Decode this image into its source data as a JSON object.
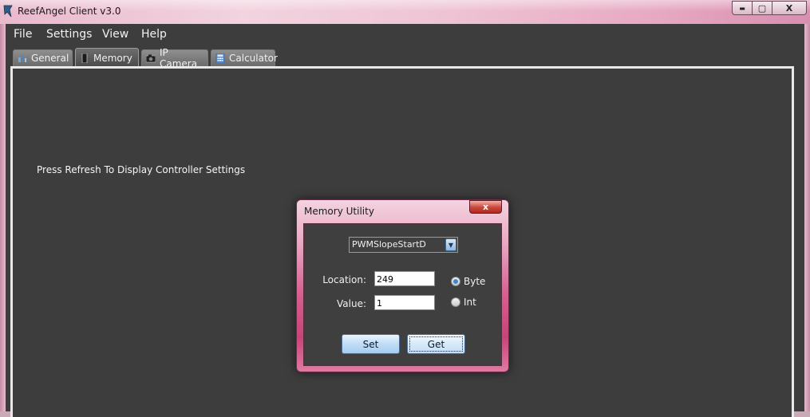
{
  "window": {
    "title": "ReefAngel Client v3.0",
    "controls": {
      "minimize": "▬",
      "maximize": "▢",
      "close": "X"
    }
  },
  "menu": {
    "items": [
      "File",
      "Settings",
      "View",
      "Help"
    ]
  },
  "tabs": [
    {
      "label": "General",
      "icon": "chart-icon",
      "active": false
    },
    {
      "label": "Memory",
      "icon": "memory-chip-icon",
      "active": true
    },
    {
      "label": "IP Camera",
      "icon": "camera-icon",
      "active": false
    },
    {
      "label": "Calculator",
      "icon": "calculator-icon",
      "active": false
    }
  ],
  "main": {
    "hint": "Press Refresh To Display Controller Settings"
  },
  "dialog": {
    "title": "Memory Utility",
    "close_label": "x",
    "select_value": "PWMSlopeStartD",
    "location_label": "Location:",
    "location_value": "249",
    "value_label": "Value:",
    "value_value": "1",
    "radio_byte_label": "Byte",
    "radio_int_label": "Int",
    "radio_selected": "Byte",
    "set_label": "Set",
    "get_label": "Get"
  },
  "colors": {
    "client_bg": "#3d3d3d",
    "frame_accent": "#d65f90",
    "radio_selected": "#3b86d6"
  }
}
